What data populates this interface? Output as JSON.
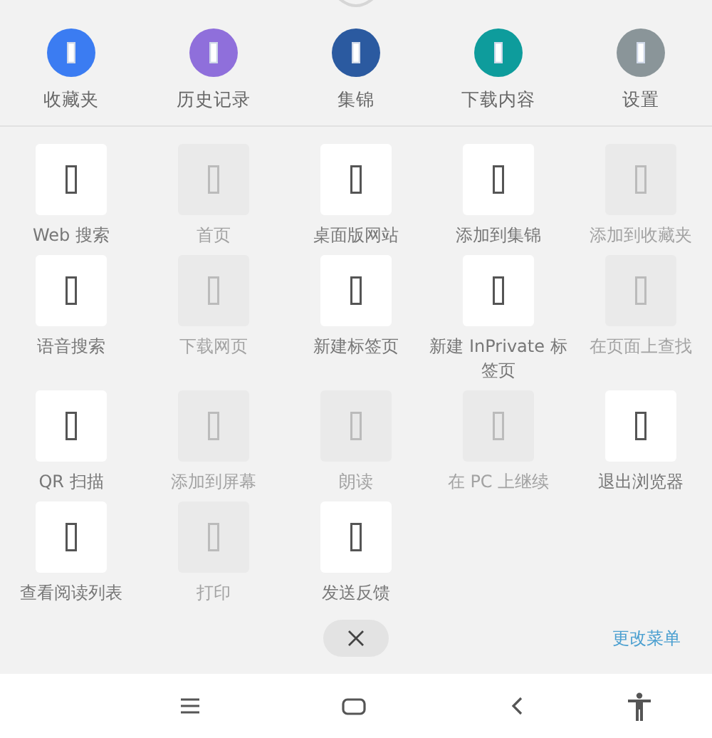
{
  "quick_actions": [
    {
      "label": "收藏夹",
      "color": "#3b7cf2"
    },
    {
      "label": "历史记录",
      "color": "#8f6fdb"
    },
    {
      "label": "集锦",
      "color": "#2b5aa0"
    },
    {
      "label": "下载内容",
      "color": "#0e9c9c"
    },
    {
      "label": "设置",
      "color": "#8a9599"
    }
  ],
  "menu_items": [
    {
      "label": "Web 搜索",
      "disabled": false
    },
    {
      "label": "首页",
      "disabled": true
    },
    {
      "label": "桌面版网站",
      "disabled": false
    },
    {
      "label": "添加到集锦",
      "disabled": false
    },
    {
      "label": "添加到收藏夹",
      "disabled": true
    },
    {
      "label": "语音搜索",
      "disabled": false
    },
    {
      "label": "下载网页",
      "disabled": true
    },
    {
      "label": "新建标签页",
      "disabled": false
    },
    {
      "label": "新建 InPrivate 标签页",
      "disabled": false
    },
    {
      "label": "在页面上查找",
      "disabled": true
    },
    {
      "label": "QR 扫描",
      "disabled": false
    },
    {
      "label": "添加到屏幕",
      "disabled": true
    },
    {
      "label": "朗读",
      "disabled": true
    },
    {
      "label": "在 PC 上继续",
      "disabled": true
    },
    {
      "label": "退出浏览器",
      "disabled": false
    },
    {
      "label": "查看阅读列表",
      "disabled": false
    },
    {
      "label": "打印",
      "disabled": true
    },
    {
      "label": "发送反馈",
      "disabled": false
    }
  ],
  "change_menu_link": "更改菜单"
}
